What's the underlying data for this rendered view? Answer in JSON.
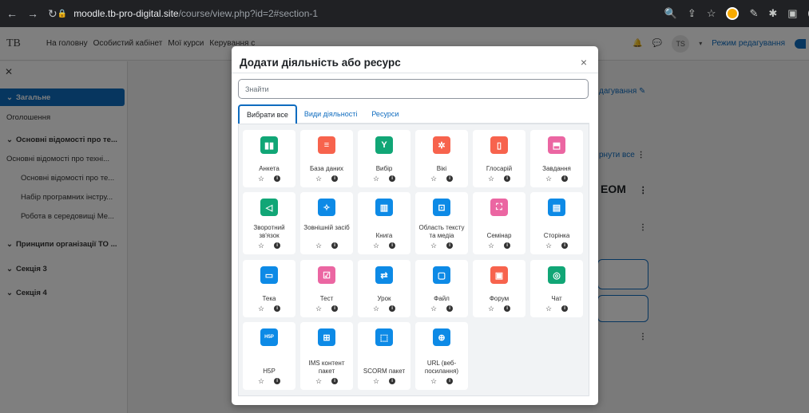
{
  "browser": {
    "host": "moodle.tb-pro-digital.site",
    "path": "/course/view.php?id=2#section-1"
  },
  "topnav": {
    "logo": "TB",
    "links": [
      "На головну",
      "Особистий кабінет",
      "Мої курси",
      "Керування с"
    ],
    "user_initials": "TS",
    "edit_mode": "Режим редагування"
  },
  "drawer": {
    "items": [
      {
        "label": "Загальне",
        "kind": "active"
      },
      {
        "label": "Оголошення",
        "kind": "sub"
      },
      {
        "label": "Основні відомості про те...",
        "kind": "sec"
      },
      {
        "label": "Основні відомості про техні...",
        "kind": "sub"
      },
      {
        "label": "Основні відомості про те...",
        "kind": "sub2"
      },
      {
        "label": "Набір програмних інстру...",
        "kind": "sub2"
      },
      {
        "label": "Робота в середовищі Ме...",
        "kind": "sub2"
      },
      {
        "label": "Принципи організації ТО ...",
        "kind": "sec"
      },
      {
        "label": "Секція 3",
        "kind": "sec"
      },
      {
        "label": "Секція 4",
        "kind": "sec"
      }
    ]
  },
  "background": {
    "edit_link": "дагування",
    "collapse_all": "рнути все",
    "heading_frag": "ЕОМ"
  },
  "modal": {
    "title": "Додати діяльність або ресурс",
    "close": "×",
    "search_placeholder": "Знайти",
    "tabs": [
      "Вибрати все",
      "Види діяльності",
      "Ресурси"
    ],
    "activities": [
      {
        "label": "Анкета",
        "color": "#11a676",
        "icon": "bar-chart-icon"
      },
      {
        "label": "База даних",
        "color": "#f7634d",
        "icon": "database-icon"
      },
      {
        "label": "Вибір",
        "color": "#11a676",
        "icon": "choice-icon"
      },
      {
        "label": "Вікі",
        "color": "#f7634d",
        "icon": "wiki-icon"
      },
      {
        "label": "Глосарій",
        "color": "#f7634d",
        "icon": "glossary-icon"
      },
      {
        "label": "Завдання",
        "color": "#eb66a2",
        "icon": "assignment-icon"
      },
      {
        "label": "Зворотний зв'язок",
        "color": "#11a676",
        "icon": "megaphone-icon"
      },
      {
        "label": "Зовнішній засіб",
        "color": "#0d8ae6",
        "icon": "puzzle-icon"
      },
      {
        "label": "Книга",
        "color": "#0d8ae6",
        "icon": "book-icon"
      },
      {
        "label": "Область тексту та медіа",
        "color": "#0d8ae6",
        "icon": "text-media-icon"
      },
      {
        "label": "Семінар",
        "color": "#eb66a2",
        "icon": "workshop-icon"
      },
      {
        "label": "Сторінка",
        "color": "#0d8ae6",
        "icon": "page-icon"
      },
      {
        "label": "Тека",
        "color": "#0d8ae6",
        "icon": "folder-icon"
      },
      {
        "label": "Тест",
        "color": "#eb66a2",
        "icon": "quiz-icon"
      },
      {
        "label": "Урок",
        "color": "#0d8ae6",
        "icon": "lesson-icon"
      },
      {
        "label": "Файл",
        "color": "#0d8ae6",
        "icon": "file-icon"
      },
      {
        "label": "Форум",
        "color": "#f7634d",
        "icon": "forum-icon"
      },
      {
        "label": "Чат",
        "color": "#11a676",
        "icon": "chat-icon"
      },
      {
        "label": "H5P",
        "color": "#0d8ae6",
        "icon": "h5p-icon"
      },
      {
        "label": "IMS контент пакет",
        "color": "#0d8ae6",
        "icon": "ims-package-icon"
      },
      {
        "label": "SCORM пакет",
        "color": "#0d8ae6",
        "icon": "scorm-icon"
      },
      {
        "label": "URL (веб-посилання)",
        "color": "#0d8ae6",
        "icon": "globe-icon"
      }
    ]
  }
}
